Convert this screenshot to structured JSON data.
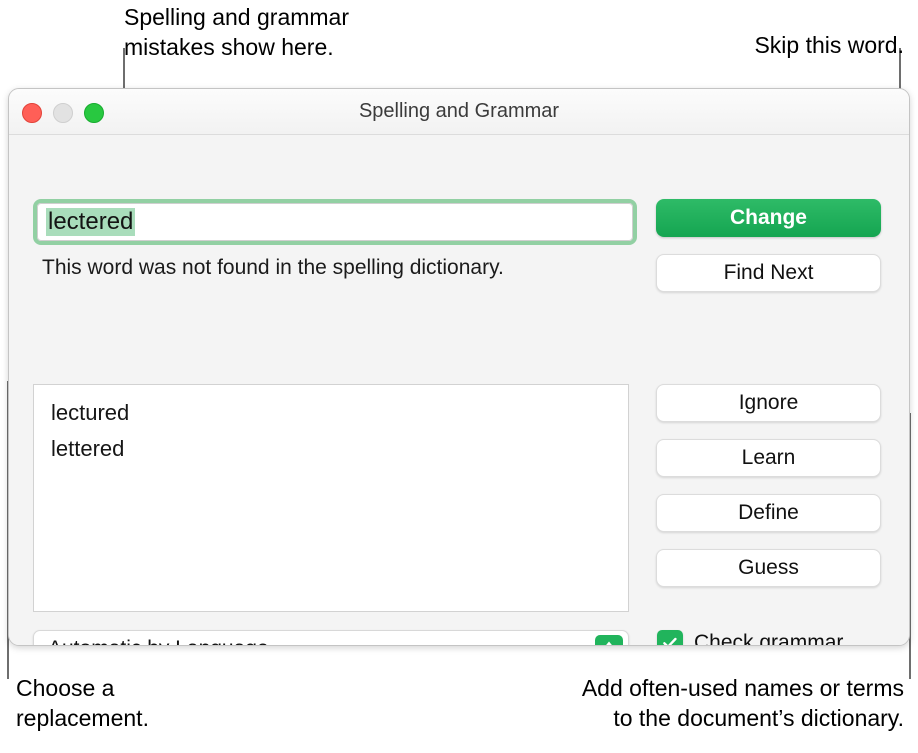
{
  "window": {
    "title": "Spelling and Grammar",
    "traffic_lights": {
      "close_color": "#ff5f57",
      "minimize_color": "#e2e2e2",
      "zoom_color": "#28c840"
    }
  },
  "word_field": {
    "value": "lectered",
    "selected": true,
    "message": "This word was not found in the spelling dictionary.",
    "focus_ring_color": "#92d0a3",
    "selection_color": "#a9ddbb"
  },
  "suggestions": {
    "items": [
      "lectured",
      "lettered"
    ]
  },
  "language_popup": {
    "value": "Automatic by Language",
    "accent_color": "#21b45c"
  },
  "check_grammar": {
    "label": "Check grammar",
    "checked": true,
    "accent_color": "#21b45c"
  },
  "buttons": {
    "change": "Change",
    "find_next": "Find Next",
    "ignore": "Ignore",
    "learn": "Learn",
    "define": "Define",
    "guess": "Guess",
    "default_color": "#15a551"
  },
  "callouts": {
    "top_left": "Spelling and grammar\nmistakes show here.",
    "top_right": "Skip this word.",
    "bottom_left": "Choose a\nreplacement.",
    "bottom_right": "Add often-used names or terms\nto the document’s dictionary."
  }
}
